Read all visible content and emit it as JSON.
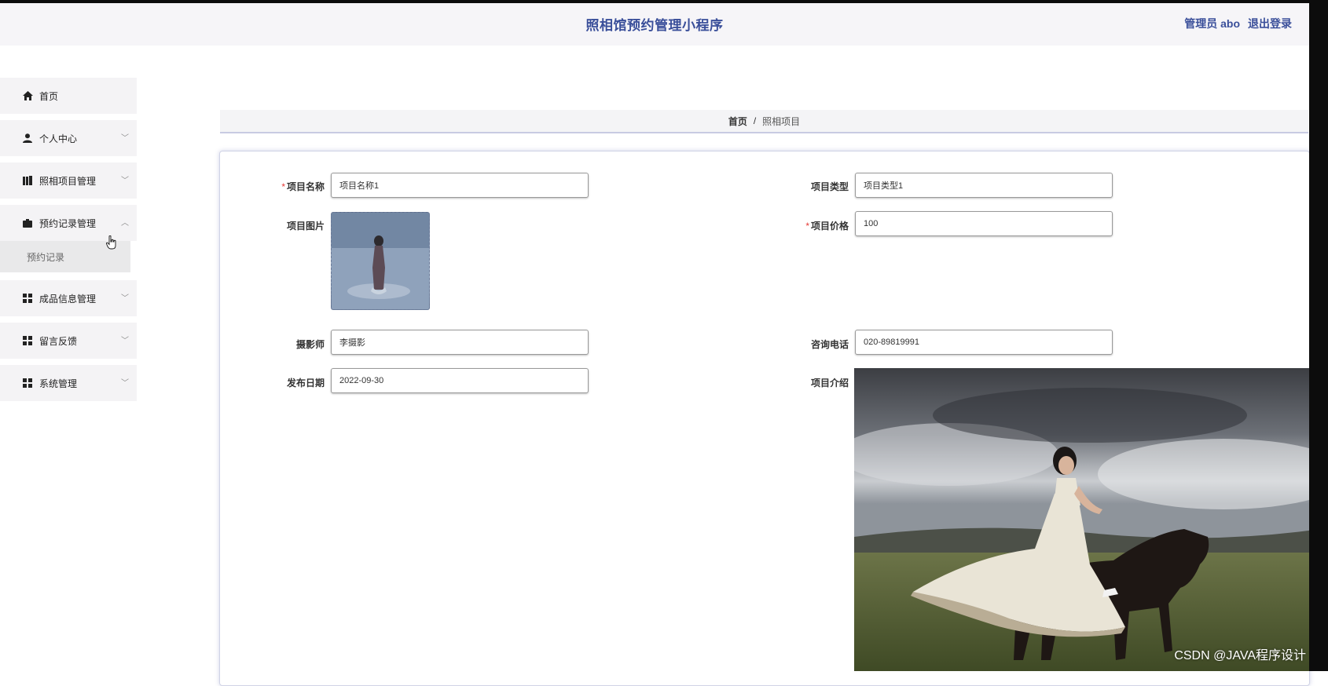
{
  "header": {
    "title": "照相馆预约管理小程序",
    "admin_label": "管理员 abo",
    "logout_label": "退出登录"
  },
  "sidebar": {
    "items": [
      {
        "label": "首页",
        "icon": "home-icon"
      },
      {
        "label": "个人中心",
        "icon": "user-icon",
        "chevron": "﹀"
      },
      {
        "label": "照相项目管理",
        "icon": "book-icon",
        "chevron": "﹀"
      },
      {
        "label": "预约记录管理",
        "icon": "briefcase-icon",
        "chevron": "︿"
      },
      {
        "label": "成品信息管理",
        "icon": "grid-icon",
        "chevron": "﹀"
      },
      {
        "label": "留言反馈",
        "icon": "grid-icon",
        "chevron": "﹀"
      },
      {
        "label": "系统管理",
        "icon": "grid-icon",
        "chevron": "﹀"
      }
    ],
    "submenu": {
      "label": "预约记录"
    }
  },
  "breadcrumb": {
    "home": "首页",
    "separator": "/",
    "current": "照相项目"
  },
  "form": {
    "project_name": {
      "label": "项目名称",
      "required": "*",
      "value": "项目名称1"
    },
    "project_type": {
      "label": "项目类型",
      "value": "项目类型1"
    },
    "project_image": {
      "label": "项目图片"
    },
    "project_price": {
      "label": "项目价格",
      "required": "*",
      "value": "100"
    },
    "photographer": {
      "label": "摄影师",
      "value": "李摄影"
    },
    "phone": {
      "label": "咨询电话",
      "value": "020-89819991"
    },
    "publish_date": {
      "label": "发布日期",
      "value": "2022-09-30"
    },
    "intro": {
      "label": "项目介绍"
    }
  },
  "watermark": "CSDN @JAVA程序设计",
  "colors": {
    "accent": "#3a4f9a",
    "required": "#e53935",
    "sidebar_bg": "#f4f3f5"
  }
}
